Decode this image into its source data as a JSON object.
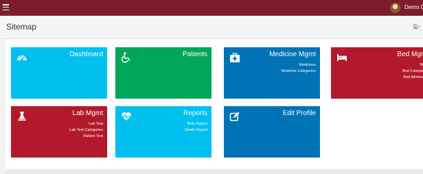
{
  "topbar": {
    "menu_icon": "hamburger-icon",
    "user_name": "Demo Doctor",
    "avatar_icon": "user-avatar"
  },
  "header": {
    "title": "Sitemap",
    "breadcrumb_icon": "home-icon",
    "breadcrumb_text": "🏠›"
  },
  "colors": {
    "topbar": "#7d1d2c",
    "cyan": "#00c0ef",
    "green": "#00a65a",
    "blue": "#0073b7",
    "red": "#b21a2c"
  },
  "tiles": [
    {
      "title": "Dashboard",
      "icon": "dashboard-gauge-icon",
      "color": "cyan",
      "links": []
    },
    {
      "title": "Patients",
      "icon": "wheelchair-icon",
      "color": "green",
      "links": []
    },
    {
      "title": "Medicine Mgmt",
      "icon": "medkit-icon",
      "color": "blue",
      "links": [
        "Medicines",
        "Medicine Categories"
      ]
    },
    {
      "title": "Bed Mgmt",
      "icon": "bed-icon",
      "color": "red",
      "links": [
        "Beds",
        "Bed Categories",
        "Bed Allotments"
      ]
    },
    {
      "title": "Lab Mgmt",
      "icon": "flask-icon",
      "color": "red",
      "links": [
        "Lab Test",
        "Lab Test Categories",
        "Patient Test"
      ]
    },
    {
      "title": "Reports",
      "icon": "heartbeat-icon",
      "color": "cyan",
      "links": [
        "Birth Report",
        "Death Report"
      ]
    },
    {
      "title": "Edit Profile",
      "icon": "edit-icon",
      "color": "blue",
      "links": []
    }
  ]
}
